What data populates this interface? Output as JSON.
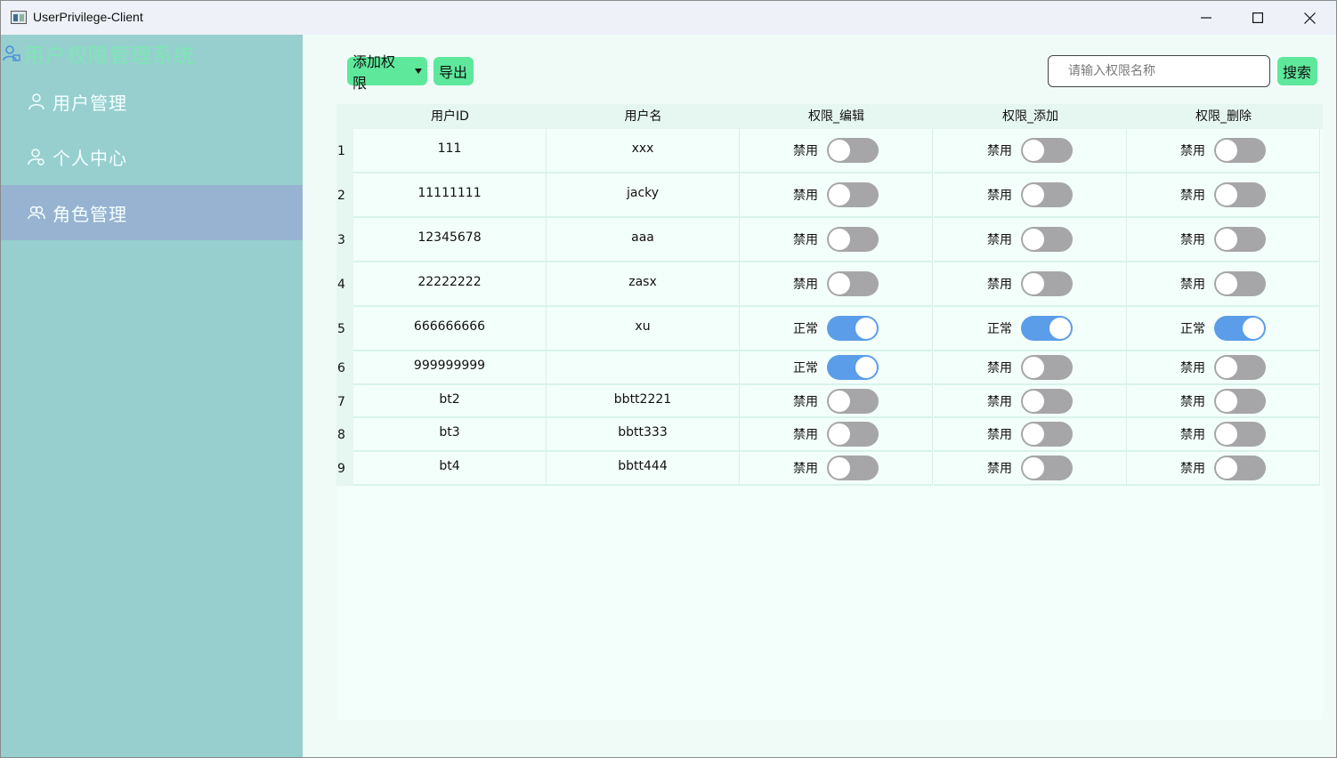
{
  "window": {
    "title": "UserPrivilege-Client"
  },
  "sidebar": {
    "brand": "用户权限管理系统",
    "items": [
      {
        "label": "用户管理",
        "icon": "user-icon"
      },
      {
        "label": "个人中心",
        "icon": "user-settings-icon"
      },
      {
        "label": "角色管理",
        "icon": "users-icon",
        "active": true
      }
    ]
  },
  "toolbar": {
    "add_label": "添加权限",
    "export_label": "导出",
    "search_placeholder": "请输入权限名称",
    "search_label": "搜索"
  },
  "table": {
    "columns": [
      "用户ID",
      "用户名",
      "权限_编辑",
      "权限_添加",
      "权限_删除"
    ],
    "rows": [
      {
        "num": "1",
        "id": "111",
        "name": "xxx",
        "perms": [
          {
            "label": "禁用",
            "on": false
          },
          {
            "label": "禁用",
            "on": false
          },
          {
            "label": "禁用",
            "on": false
          }
        ]
      },
      {
        "num": "2",
        "id": "11111111",
        "name": "jacky",
        "perms": [
          {
            "label": "禁用",
            "on": false
          },
          {
            "label": "禁用",
            "on": false
          },
          {
            "label": "禁用",
            "on": false
          }
        ]
      },
      {
        "num": "3",
        "id": "12345678",
        "name": "aaa",
        "perms": [
          {
            "label": "禁用",
            "on": false
          },
          {
            "label": "禁用",
            "on": false
          },
          {
            "label": "禁用",
            "on": false
          }
        ]
      },
      {
        "num": "4",
        "id": "22222222",
        "name": "zasx",
        "perms": [
          {
            "label": "禁用",
            "on": false
          },
          {
            "label": "禁用",
            "on": false
          },
          {
            "label": "禁用",
            "on": false
          }
        ]
      },
      {
        "num": "5",
        "id": "666666666",
        "name": "xu",
        "perms": [
          {
            "label": "正常",
            "on": true
          },
          {
            "label": "正常",
            "on": true
          },
          {
            "label": "正常",
            "on": true
          }
        ]
      },
      {
        "num": "6",
        "id": "999999999",
        "name": "",
        "perms": [
          {
            "label": "正常",
            "on": true
          },
          {
            "label": "禁用",
            "on": false
          },
          {
            "label": "禁用",
            "on": false
          }
        ]
      },
      {
        "num": "7",
        "id": "bt2",
        "name": "bbtt2221",
        "perms": [
          {
            "label": "禁用",
            "on": false
          },
          {
            "label": "禁用",
            "on": false
          },
          {
            "label": "禁用",
            "on": false
          }
        ]
      },
      {
        "num": "8",
        "id": "bt3",
        "name": "bbtt333",
        "perms": [
          {
            "label": "禁用",
            "on": false
          },
          {
            "label": "禁用",
            "on": false
          },
          {
            "label": "禁用",
            "on": false
          }
        ]
      },
      {
        "num": "9",
        "id": "bt4",
        "name": "bbtt444",
        "perms": [
          {
            "label": "禁用",
            "on": false
          },
          {
            "label": "禁用",
            "on": false
          },
          {
            "label": "禁用",
            "on": false
          }
        ]
      }
    ]
  },
  "colors": {
    "sidebar_bg": "#97cfcf",
    "sidebar_active": "#97b3d1",
    "brand_text": "#7ee6b4",
    "button_green": "#5ee89b",
    "switch_on": "#5b9de8",
    "switch_off": "#a6a6a8"
  }
}
